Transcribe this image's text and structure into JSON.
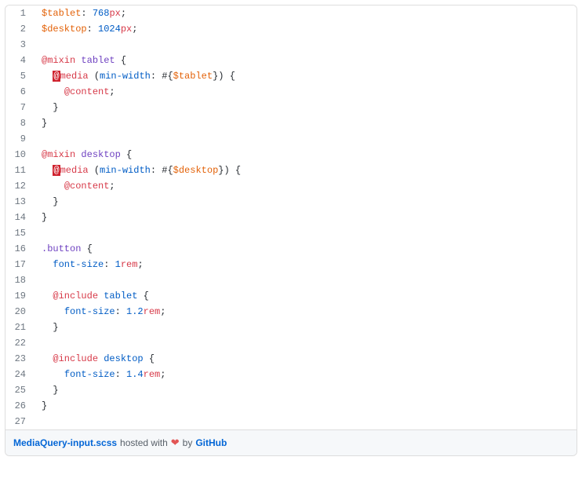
{
  "footer": {
    "filename": "MediaQuery-input.scss",
    "hosted_with": " hosted with ",
    "by": " by ",
    "github": "GitHub",
    "heart": "❤"
  },
  "lines": [
    {
      "n": "1",
      "tokens": [
        {
          "t": "$tablet",
          "c": "c-var"
        },
        {
          "t": ": "
        },
        {
          "t": "768",
          "c": "c-num"
        },
        {
          "t": "px",
          "c": "c-unit"
        },
        {
          "t": ";"
        }
      ]
    },
    {
      "n": "2",
      "tokens": [
        {
          "t": "$desktop",
          "c": "c-var"
        },
        {
          "t": ": "
        },
        {
          "t": "1024",
          "c": "c-num"
        },
        {
          "t": "px",
          "c": "c-unit"
        },
        {
          "t": ";"
        }
      ]
    },
    {
      "n": "3",
      "tokens": []
    },
    {
      "n": "4",
      "tokens": [
        {
          "t": "@mixin",
          "c": "c-at"
        },
        {
          "t": " "
        },
        {
          "t": "tablet",
          "c": "c-kw"
        },
        {
          "t": " "
        },
        {
          "t": "{",
          "c": "c-brace"
        }
      ]
    },
    {
      "n": "5",
      "tokens": [
        {
          "t": "  "
        },
        {
          "t": "@",
          "c": "hl-error"
        },
        {
          "t": "media",
          "c": "c-at"
        },
        {
          "t": " ("
        },
        {
          "t": "min-width",
          "c": "c-prop"
        },
        {
          "t": ": "
        },
        {
          "t": "#{",
          "c": "c-interp"
        },
        {
          "t": "$tablet",
          "c": "c-var"
        },
        {
          "t": "}",
          "c": "c-interp"
        },
        {
          "t": ") "
        },
        {
          "t": "{",
          "c": "c-brace"
        }
      ]
    },
    {
      "n": "6",
      "tokens": [
        {
          "t": "    "
        },
        {
          "t": "@content",
          "c": "c-at"
        },
        {
          "t": ";"
        }
      ]
    },
    {
      "n": "7",
      "tokens": [
        {
          "t": "  "
        },
        {
          "t": "}",
          "c": "c-brace"
        }
      ]
    },
    {
      "n": "8",
      "tokens": [
        {
          "t": "}",
          "c": "c-brace"
        }
      ]
    },
    {
      "n": "9",
      "tokens": []
    },
    {
      "n": "10",
      "tokens": [
        {
          "t": "@mixin",
          "c": "c-at"
        },
        {
          "t": " "
        },
        {
          "t": "desktop",
          "c": "c-kw"
        },
        {
          "t": " "
        },
        {
          "t": "{",
          "c": "c-brace"
        }
      ]
    },
    {
      "n": "11",
      "tokens": [
        {
          "t": "  "
        },
        {
          "t": "@",
          "c": "hl-error"
        },
        {
          "t": "media",
          "c": "c-at"
        },
        {
          "t": " ("
        },
        {
          "t": "min-width",
          "c": "c-prop"
        },
        {
          "t": ": "
        },
        {
          "t": "#{",
          "c": "c-interp"
        },
        {
          "t": "$desktop",
          "c": "c-var"
        },
        {
          "t": "}",
          "c": "c-interp"
        },
        {
          "t": ") "
        },
        {
          "t": "{",
          "c": "c-brace"
        }
      ]
    },
    {
      "n": "12",
      "tokens": [
        {
          "t": "    "
        },
        {
          "t": "@content",
          "c": "c-at"
        },
        {
          "t": ";"
        }
      ]
    },
    {
      "n": "13",
      "tokens": [
        {
          "t": "  "
        },
        {
          "t": "}",
          "c": "c-brace"
        }
      ]
    },
    {
      "n": "14",
      "tokens": [
        {
          "t": "}",
          "c": "c-brace"
        }
      ]
    },
    {
      "n": "15",
      "tokens": []
    },
    {
      "n": "16",
      "tokens": [
        {
          "t": ".button",
          "c": "c-sel"
        },
        {
          "t": " "
        },
        {
          "t": "{",
          "c": "c-brace"
        }
      ]
    },
    {
      "n": "17",
      "tokens": [
        {
          "t": "  "
        },
        {
          "t": "font-size",
          "c": "c-prop"
        },
        {
          "t": ": "
        },
        {
          "t": "1",
          "c": "c-num"
        },
        {
          "t": "rem",
          "c": "c-unit"
        },
        {
          "t": ";"
        }
      ]
    },
    {
      "n": "18",
      "tokens": []
    },
    {
      "n": "19",
      "tokens": [
        {
          "t": "  "
        },
        {
          "t": "@include",
          "c": "c-at"
        },
        {
          "t": " "
        },
        {
          "t": "tablet",
          "c": "c-name"
        },
        {
          "t": " "
        },
        {
          "t": "{",
          "c": "c-brace"
        }
      ]
    },
    {
      "n": "20",
      "tokens": [
        {
          "t": "    "
        },
        {
          "t": "font-size",
          "c": "c-prop"
        },
        {
          "t": ": "
        },
        {
          "t": "1.2",
          "c": "c-num"
        },
        {
          "t": "rem",
          "c": "c-unit"
        },
        {
          "t": ";"
        }
      ]
    },
    {
      "n": "21",
      "tokens": [
        {
          "t": "  "
        },
        {
          "t": "}",
          "c": "c-brace"
        }
      ]
    },
    {
      "n": "22",
      "tokens": []
    },
    {
      "n": "23",
      "tokens": [
        {
          "t": "  "
        },
        {
          "t": "@include",
          "c": "c-at"
        },
        {
          "t": " "
        },
        {
          "t": "desktop",
          "c": "c-name"
        },
        {
          "t": " "
        },
        {
          "t": "{",
          "c": "c-brace"
        }
      ]
    },
    {
      "n": "24",
      "tokens": [
        {
          "t": "    "
        },
        {
          "t": "font-size",
          "c": "c-prop"
        },
        {
          "t": ": "
        },
        {
          "t": "1.4",
          "c": "c-num"
        },
        {
          "t": "rem",
          "c": "c-unit"
        },
        {
          "t": ";"
        }
      ]
    },
    {
      "n": "25",
      "tokens": [
        {
          "t": "  "
        },
        {
          "t": "}",
          "c": "c-brace"
        }
      ]
    },
    {
      "n": "26",
      "tokens": [
        {
          "t": "}",
          "c": "c-brace"
        }
      ]
    },
    {
      "n": "27",
      "tokens": []
    }
  ]
}
